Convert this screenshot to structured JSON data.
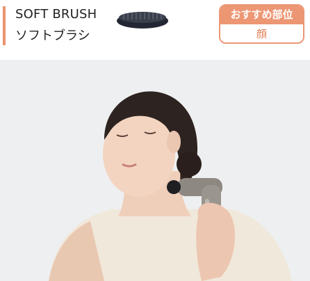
{
  "product": {
    "name_en": "SOFT BRUSH",
    "name_ja": "ソフトブラシ"
  },
  "recommend": {
    "label": "おすすめ部位",
    "value": "顔"
  },
  "icons": {
    "attachment": "soft-brush-attachment-icon"
  },
  "colors": {
    "accent": "#e9936f",
    "badge": "#ec9674",
    "badge_text": "#e07f58",
    "photo_bg": "#eeeff0"
  }
}
